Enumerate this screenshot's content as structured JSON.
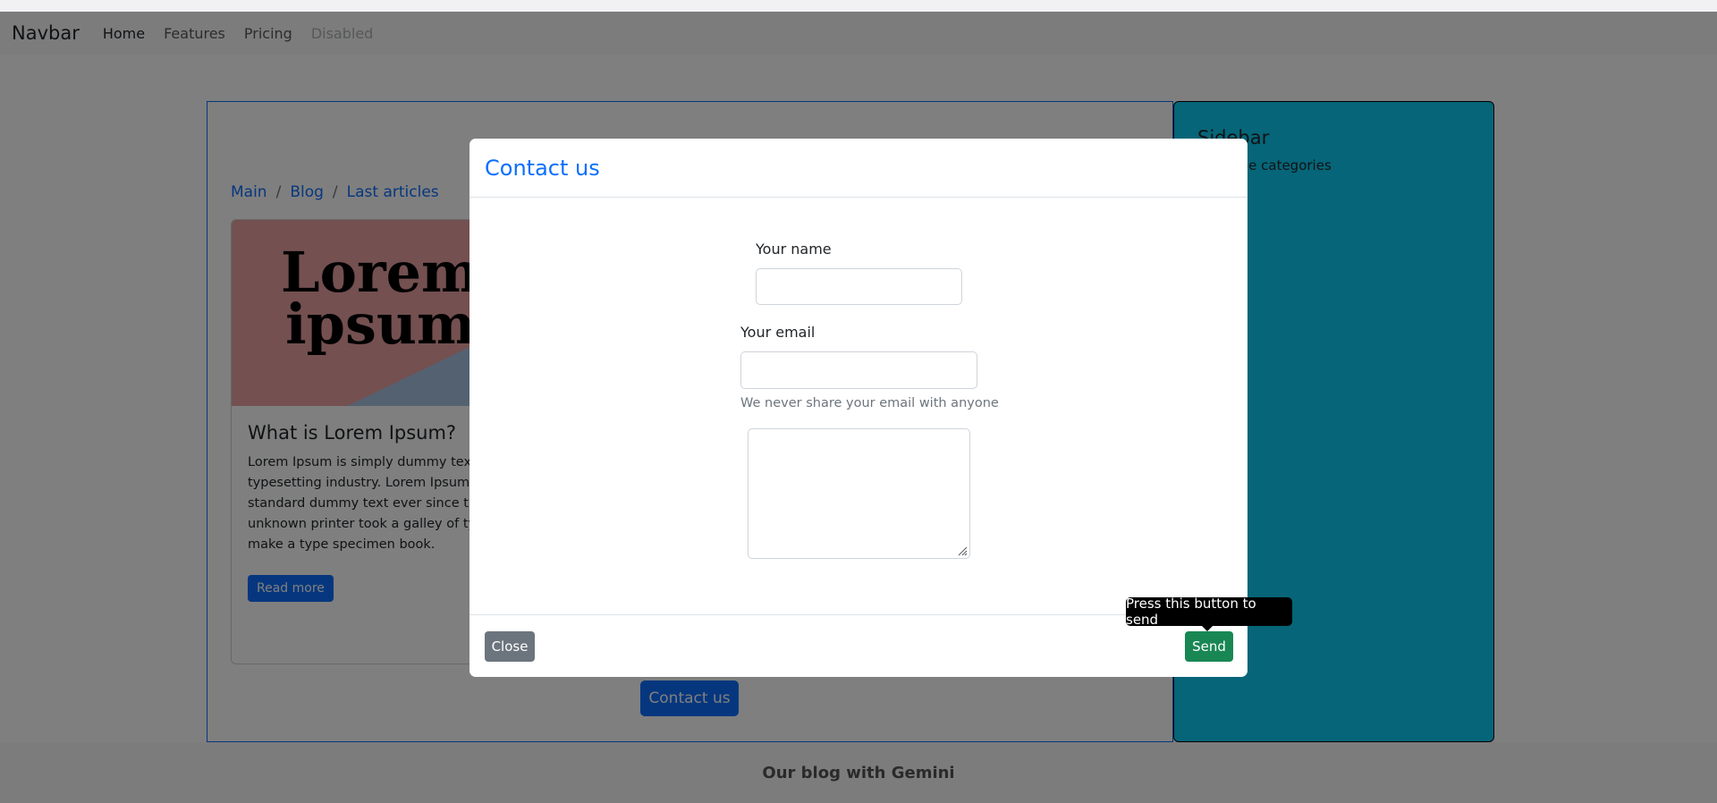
{
  "navbar": {
    "brand": "Navbar",
    "links": [
      {
        "label": "Home",
        "state": "active"
      },
      {
        "label": "Features",
        "state": "normal"
      },
      {
        "label": "Pricing",
        "state": "normal"
      },
      {
        "label": "Disabled",
        "state": "disabled"
      }
    ]
  },
  "breadcrumb": [
    "Main",
    "Blog",
    "Last articles"
  ],
  "breadcrumb_separator": "/",
  "card": {
    "image_text": [
      "Lorem",
      "ipsum"
    ],
    "title": "What is Lorem Ipsum?",
    "text": "Lorem Ipsum is simply dummy text of the printing and typesetting industry. Lorem Ipsum has been the industry's standard dummy text ever since the 1500s, when an unknown printer took a galley of type and scrambled it to make a type specimen book.",
    "button_label": "Read more"
  },
  "contact_button_label": "Contact us",
  "sidebar": {
    "title": "Sidebar",
    "text": "Could be categories"
  },
  "footer": {
    "text": "Our blog with Gemini"
  },
  "modal": {
    "title": "Contact us",
    "name_label": "Your name",
    "name_value": "",
    "email_label": "Your email",
    "email_value": "",
    "email_help": "We never share your email with anyone",
    "message_value": "",
    "close_label": "Close",
    "send_label": "Send",
    "send_tooltip": "Press this button to send"
  },
  "colors": {
    "primary": "#0d6efd",
    "secondary": "#6c757d",
    "success": "#198754",
    "sidebar_bg": "#0dcaf0"
  }
}
